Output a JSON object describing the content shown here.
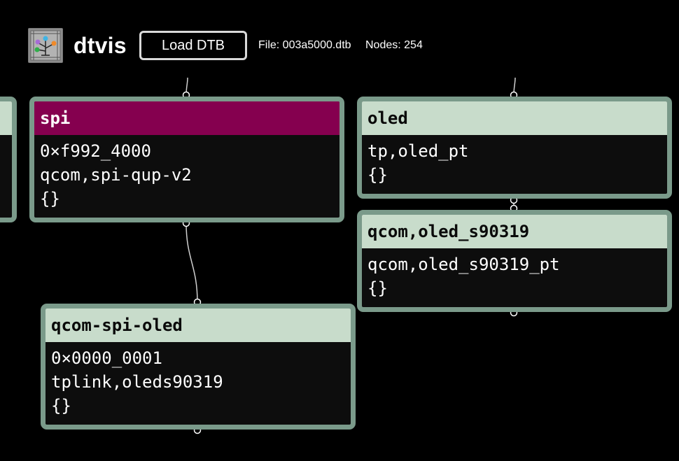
{
  "app": {
    "title": "dtvis",
    "logo_icon": "tree-logo-icon",
    "load_button": "Load DTB",
    "file_label": "File: 003a5000.dtb",
    "nodes_label": "Nodes: 254"
  },
  "colors": {
    "background": "#000000",
    "node_border": "#7a9a8a",
    "node_header": "#c8dccb",
    "selected_header": "#85004f",
    "node_body": "#0d0d0d"
  },
  "graph": {
    "nodes": [
      {
        "id": "spi",
        "title": "spi",
        "selected": true,
        "props": [
          "0×f992_4000",
          "qcom,spi-qup-v2",
          "{}"
        ]
      },
      {
        "id": "qcom-spi-oled",
        "title": "qcom-spi-oled",
        "selected": false,
        "props": [
          "0×0000_0001",
          "tplink,oleds90319",
          "{}"
        ]
      },
      {
        "id": "oled",
        "title": "oled",
        "selected": false,
        "props": [
          "tp,oled_pt",
          "{}"
        ]
      },
      {
        "id": "qcom-oled-s90319",
        "title": "qcom,oled_s90319",
        "selected": false,
        "props": [
          "qcom,oled_s90319_pt",
          "{}"
        ]
      }
    ]
  }
}
